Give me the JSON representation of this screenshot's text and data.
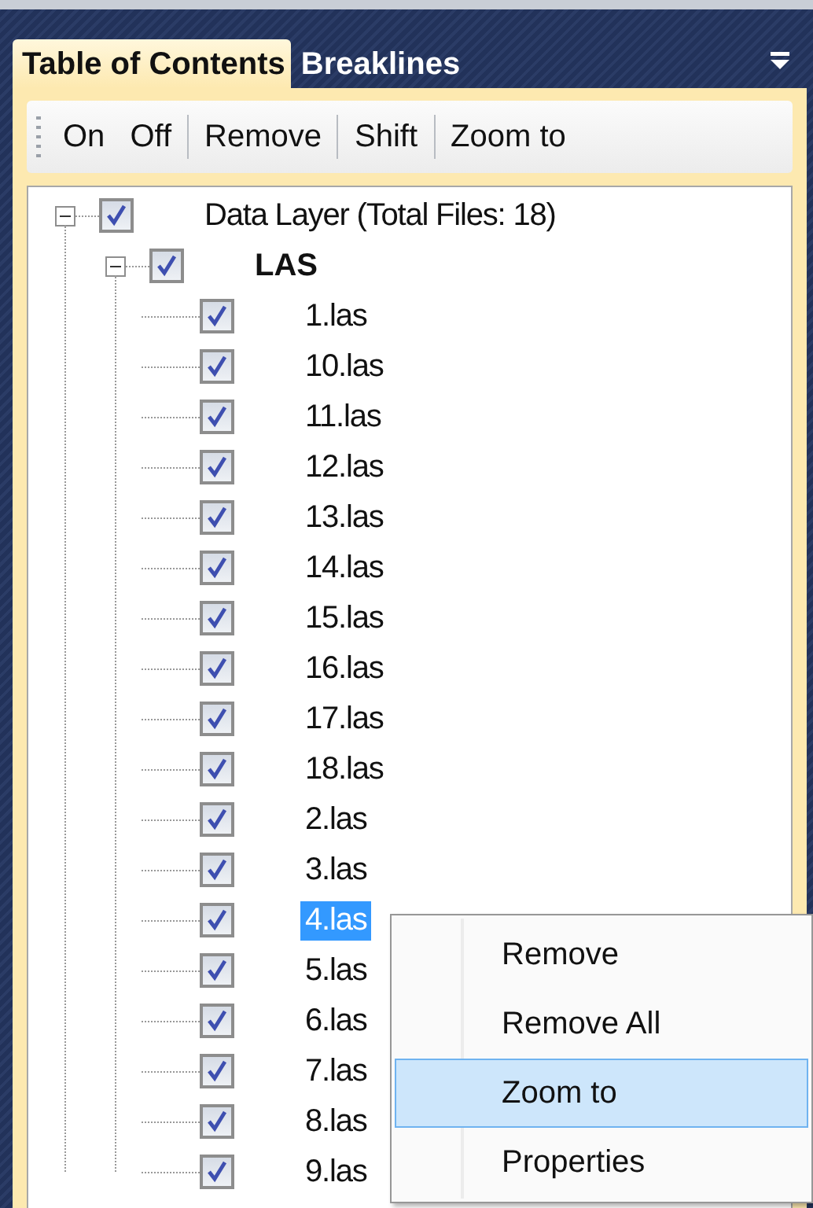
{
  "tabs": [
    {
      "label": "Table of Contents",
      "selected": true
    },
    {
      "label": "Breaklines",
      "selected": false
    }
  ],
  "toolbar": {
    "groups": [
      [
        "On",
        "Off"
      ],
      [
        "Remove"
      ],
      [
        "Shift"
      ],
      [
        "Zoom to"
      ]
    ]
  },
  "tree": [
    {
      "label": "Data Layer (Total Files: 18)",
      "bold": false,
      "checked": true,
      "expanded": true,
      "selected": false,
      "children": [
        {
          "label": "LAS",
          "bold": true,
          "checked": true,
          "expanded": true,
          "selected": false,
          "children": [
            {
              "label": "1.las",
              "checked": true,
              "selected": false
            },
            {
              "label": "10.las",
              "checked": true,
              "selected": false
            },
            {
              "label": "11.las",
              "checked": true,
              "selected": false
            },
            {
              "label": "12.las",
              "checked": true,
              "selected": false
            },
            {
              "label": "13.las",
              "checked": true,
              "selected": false
            },
            {
              "label": "14.las",
              "checked": true,
              "selected": false
            },
            {
              "label": "15.las",
              "checked": true,
              "selected": false
            },
            {
              "label": "16.las",
              "checked": true,
              "selected": false
            },
            {
              "label": "17.las",
              "checked": true,
              "selected": false
            },
            {
              "label": "18.las",
              "checked": true,
              "selected": false
            },
            {
              "label": "2.las",
              "checked": true,
              "selected": false
            },
            {
              "label": "3.las",
              "checked": true,
              "selected": false
            },
            {
              "label": "4.las",
              "checked": true,
              "selected": true
            },
            {
              "label": "5.las",
              "checked": true,
              "selected": false
            },
            {
              "label": "6.las",
              "checked": true,
              "selected": false
            },
            {
              "label": "7.las",
              "checked": true,
              "selected": false
            },
            {
              "label": "8.las",
              "checked": true,
              "selected": false
            },
            {
              "label": "9.las",
              "checked": true,
              "selected": false
            }
          ]
        }
      ]
    }
  ],
  "context_menu": {
    "items": [
      {
        "label": "Remove",
        "selected": false
      },
      {
        "label": "Remove All",
        "selected": false
      },
      {
        "label": "Zoom to",
        "selected": true
      },
      {
        "label": "Properties",
        "selected": false
      }
    ]
  }
}
